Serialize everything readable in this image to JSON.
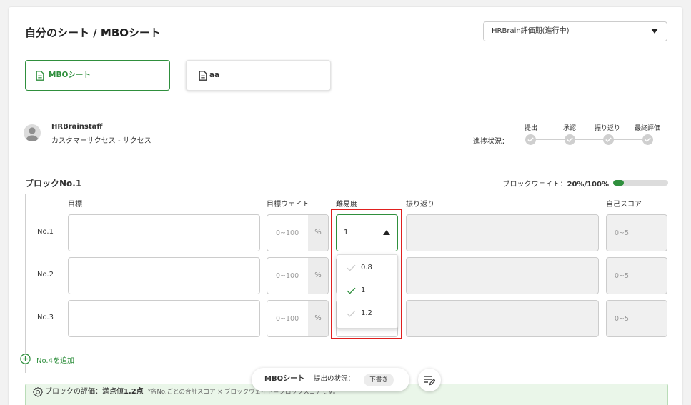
{
  "header": {
    "title": "自分のシート / MBOシート",
    "period_select": {
      "value": "HRBrain評価期(進行中)",
      "icon": "caret-down-icon"
    }
  },
  "sheet_tabs": [
    {
      "label": "MBOシート",
      "icon": "document-icon",
      "active": true
    },
    {
      "label": "aa",
      "icon": "document-icon",
      "active": false
    }
  ],
  "user": {
    "name": "HRBrainstaff",
    "department": "カスタマーサクセス - サクセス",
    "avatar_icon": "user-avatar-icon"
  },
  "progress": {
    "label": "進捗状況：",
    "steps": [
      {
        "label": "提出"
      },
      {
        "label": "承認"
      },
      {
        "label": "振り返り"
      },
      {
        "label": "最終評価"
      }
    ],
    "step_icon": "check-icon"
  },
  "block": {
    "title": "ブロックNo.1",
    "weight": {
      "label": "ブロックウェイト：",
      "value": "20%/100%",
      "fraction": 0.2
    },
    "columns": {
      "goal": "目標",
      "weight": "目標ウェイト",
      "difficulty": "難易度",
      "reflection": "振り返り",
      "score": "自己スコア"
    },
    "rows": [
      {
        "label": "No.1",
        "goal_value": "",
        "weight_placeholder": "0~100",
        "weight_unit": "%",
        "difficulty_value": "1",
        "score_placeholder": "0~5"
      },
      {
        "label": "No.2",
        "goal_value": "",
        "weight_placeholder": "0~100",
        "weight_unit": "%",
        "score_placeholder": "0~5"
      },
      {
        "label": "No.3",
        "goal_value": "",
        "weight_placeholder": "0~100",
        "weight_unit": "%",
        "score_placeholder": "0~5"
      }
    ],
    "difficulty_dropdown": {
      "open": true,
      "icon": "caret-up-icon",
      "options": [
        {
          "label": "0.8",
          "selected": false
        },
        {
          "label": "1",
          "selected": true
        },
        {
          "label": "1.2",
          "selected": false
        }
      ]
    },
    "add_row": {
      "label": "No.4を追加",
      "icon": "plus-circle-icon"
    },
    "evaluation": {
      "label": "ブロックの評価：満点値",
      "max_score": "1.2点",
      "note": "*各No.ごとの合計スコア × ブロックウェイト＝ブロックスコアです。",
      "icon": "badge-icon"
    }
  },
  "footer_bar": {
    "sheet_name": "MBOシート",
    "status_label": "提出の状況：",
    "status_badge": "下書き",
    "edit_button_icon": "list-edit-icon"
  },
  "colors": {
    "accent_green": "#2f8f3d",
    "highlight_red": "#e0201f",
    "disabled_field": "#f0f0f0",
    "page_background": "#f2f2f2"
  }
}
